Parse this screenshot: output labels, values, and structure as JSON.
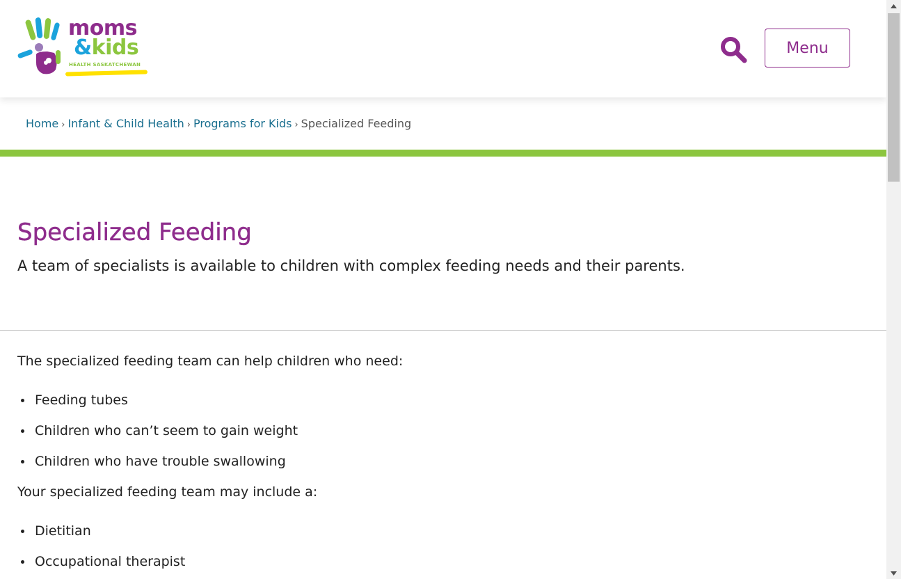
{
  "colors": {
    "purple": "#8e2c8c",
    "teal_link": "#1a6f8f",
    "green": "#8cc63f",
    "blue": "#1ba3dc",
    "yellow": "#ffe100",
    "text": "#222222"
  },
  "logo": {
    "line1": "moms",
    "line2_amp": "&",
    "line2_word": "kids",
    "subtitle": "HEALTH SASKATCHEWAN",
    "icon": "handprint-logo-icon"
  },
  "header": {
    "search_icon": "search-icon",
    "menu_label": "Menu"
  },
  "breadcrumb": {
    "items": [
      "Home",
      "Infant & Child Health",
      "Programs for Kids"
    ],
    "current": "Specialized Feeding",
    "separator": "›"
  },
  "page": {
    "title": "Specialized Feeding",
    "subtitle": "A team of specialists is available to children with complex feeding needs and their parents."
  },
  "content": {
    "intro1": "The specialized feeding team can help children who need:",
    "list1": [
      "Feeding tubes",
      "Children who can’t seem to gain weight",
      "Children who have trouble swallowing"
    ],
    "intro2": "Your specialized feeding team may include a:",
    "list2": [
      "Dietitian",
      "Occupational therapist"
    ]
  },
  "scrollbar": {
    "up_icon": "scroll-up-arrow-icon",
    "down_icon": "scroll-down-arrow-icon"
  }
}
